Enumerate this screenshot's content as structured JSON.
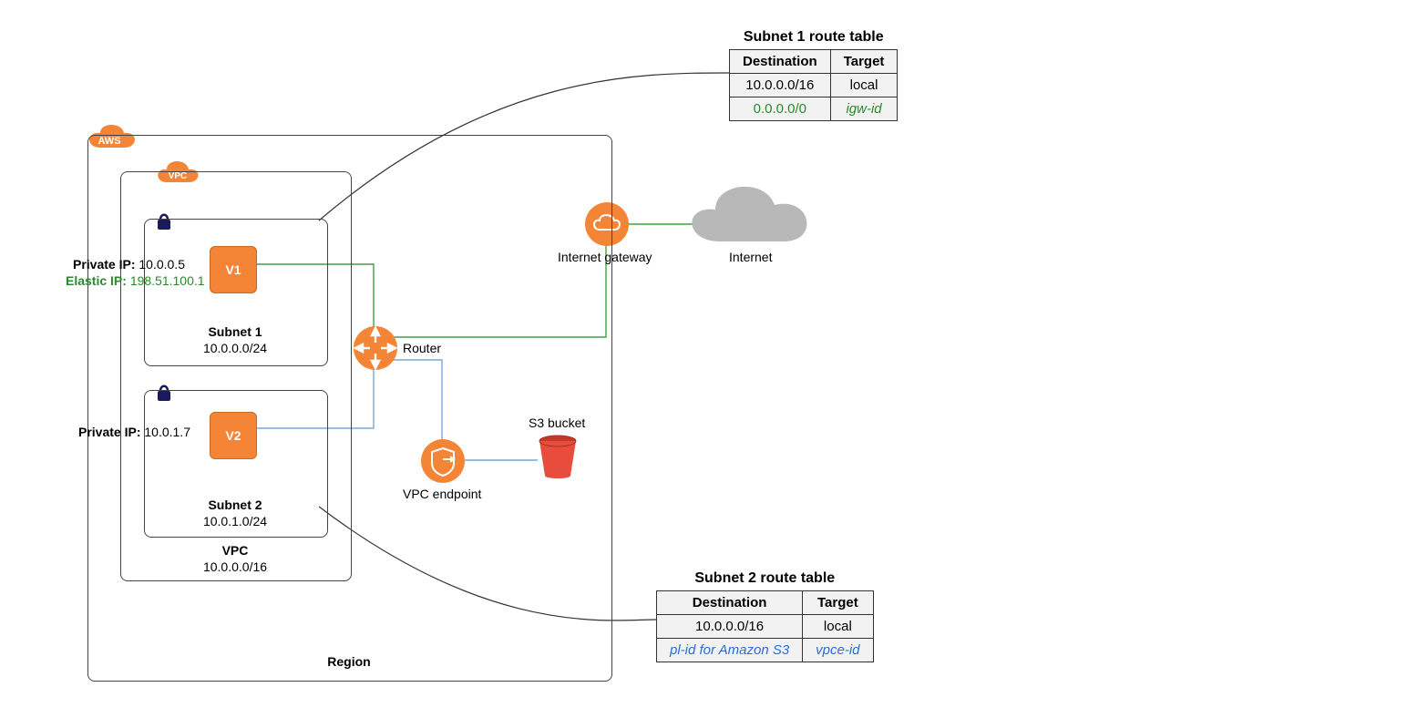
{
  "cloud_labels": {
    "aws": "AWS",
    "vpc": "VPC"
  },
  "region_label": "Region",
  "vpc": {
    "title": "VPC",
    "cidr": "10.0.0.0/16"
  },
  "subnet1": {
    "title": "Subnet 1",
    "cidr": "10.0.0.0/24",
    "instance": "V1",
    "private_ip_label": "Private IP:",
    "private_ip": "10.0.0.5",
    "elastic_ip_label": "Elastic IP:",
    "elastic_ip": "198.51.100.1"
  },
  "subnet2": {
    "title": "Subnet 2",
    "cidr": "10.0.1.0/24",
    "instance": "V2",
    "private_ip_label": "Private IP:",
    "private_ip": "10.0.1.7"
  },
  "nodes": {
    "router": "Router",
    "igw": "Internet gateway",
    "internet": "Internet",
    "vpce": "VPC endpoint",
    "s3": "S3 bucket"
  },
  "route_table_1": {
    "caption": "Subnet 1 route table",
    "headers": {
      "dest": "Destination",
      "target": "Target"
    },
    "rows": [
      {
        "dest": "10.0.0.0/16",
        "target": "local",
        "style": "plain"
      },
      {
        "dest": "0.0.0.0/0",
        "target": "igw-id",
        "style": "green-ital"
      }
    ]
  },
  "route_table_2": {
    "caption": "Subnet 2 route table",
    "headers": {
      "dest": "Destination",
      "target": "Target"
    },
    "rows": [
      {
        "dest": "10.0.0.0/16",
        "target": "local",
        "style": "plain"
      },
      {
        "dest": "pl-id for Amazon S3",
        "target": "vpce-id",
        "style": "blue-ital"
      }
    ]
  }
}
